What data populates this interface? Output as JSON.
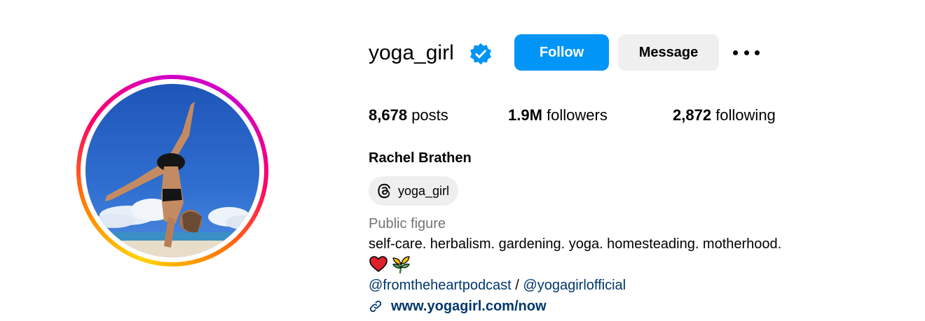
{
  "profile": {
    "username": "yoga_girl",
    "verified": true,
    "full_name": "Rachel Brathen",
    "category": "Public figure",
    "bio": "self-care. herbalism. gardening. yoga. homesteading. motherhood.",
    "bio_emojis": [
      "red-heart",
      "herb-sprout"
    ]
  },
  "actions": {
    "follow_label": "Follow",
    "message_label": "Message",
    "more_icon": "ellipsis-icon"
  },
  "stats": {
    "posts_count": "8,678",
    "posts_label": "posts",
    "followers_count": "1.9M",
    "followers_label": "followers",
    "following_count": "2,872",
    "following_label": "following"
  },
  "threads": {
    "label": "yoga_girl",
    "icon": "threads-icon"
  },
  "mentions": {
    "first": "@fromtheheartpodcast",
    "separator": " / ",
    "second": "@yogagirlofficial"
  },
  "website": {
    "url": "www.yogagirl.com/now",
    "icon": "link-icon"
  },
  "colors": {
    "follow_button": "#0095f6",
    "secondary_button": "#efefef",
    "link": "#00376b",
    "muted_text": "#737373",
    "verified_badge": "#0095f6"
  }
}
